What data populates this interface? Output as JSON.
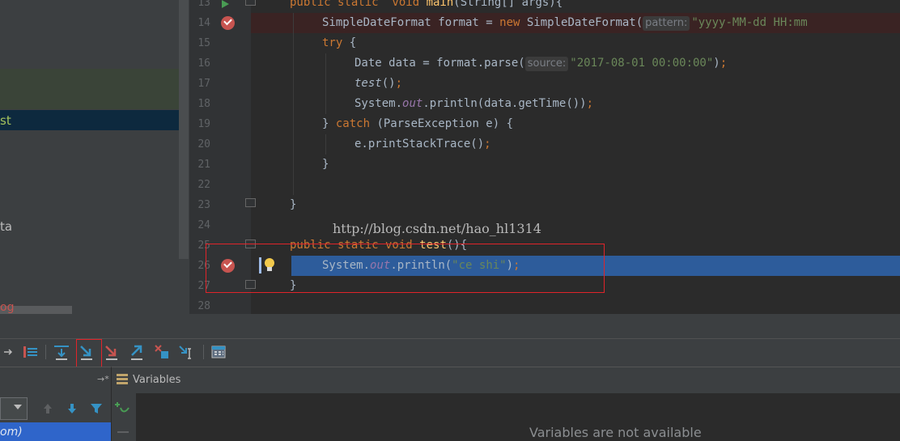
{
  "project_tree": {
    "selected_label": "st",
    "item_ta_label": "ta",
    "item_og_label": "og"
  },
  "editor": {
    "line_numbers": [
      "13",
      "14",
      "15",
      "16",
      "17",
      "18",
      "19",
      "20",
      "21",
      "22",
      "23",
      "24",
      "25",
      "26",
      "27",
      "28"
    ],
    "hints": {
      "pattern": "pattern:",
      "source": "source:"
    },
    "strings": {
      "date_format": "\"yyyy-MM-dd HH:mm",
      "date_value": "\"2017-08-01 00:00:00\"",
      "ce_shi": "\"ce shi\""
    },
    "watermark": "http://blog.csdn.net/hao_hl1314"
  },
  "debug_toolbar": {
    "buttons": [
      "show-execution-point",
      "step-over",
      "step-into",
      "force-step-into",
      "step-out",
      "drop-frame",
      "run-to-cursor",
      "evaluate-expression"
    ]
  },
  "frames_panel": {
    "frame_label": "om)"
  },
  "variables_panel": {
    "title": "Variables",
    "empty_message": "Variables are not available"
  },
  "colors": {
    "editor_bg": "#2b2b2b",
    "execution_line": "#2d5c9b",
    "breakpoint": "#c75450",
    "keyword": "#cc7832",
    "string": "#6a8759"
  }
}
